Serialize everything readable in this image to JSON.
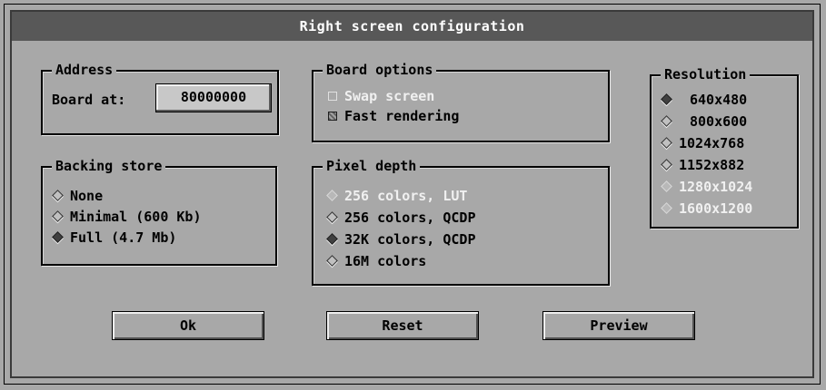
{
  "window": {
    "title": "Right screen configuration"
  },
  "address": {
    "legend": "Address",
    "board_label": "Board at:",
    "board_value": "80000000"
  },
  "board_options": {
    "legend": "Board options",
    "items": [
      {
        "label": "Swap screen",
        "checked": false,
        "enabled": false
      },
      {
        "label": "Fast rendering",
        "checked": true,
        "enabled": true
      }
    ]
  },
  "resolution": {
    "legend": "Resolution",
    "items": [
      {
        "label": "640x480",
        "selected": true,
        "enabled": true
      },
      {
        "label": "800x600",
        "selected": false,
        "enabled": true
      },
      {
        "label": "1024x768",
        "selected": false,
        "enabled": true
      },
      {
        "label": "1152x882",
        "selected": false,
        "enabled": true
      },
      {
        "label": "1280x1024",
        "selected": false,
        "enabled": false
      },
      {
        "label": "1600x1200",
        "selected": false,
        "enabled": false
      }
    ]
  },
  "backing_store": {
    "legend": "Backing store",
    "items": [
      {
        "label": "None",
        "selected": false,
        "enabled": true
      },
      {
        "label": "Minimal (600 Kb)",
        "selected": false,
        "enabled": true
      },
      {
        "label": "Full (4.7 Mb)",
        "selected": true,
        "enabled": true
      }
    ]
  },
  "pixel_depth": {
    "legend": "Pixel depth",
    "items": [
      {
        "label": "256 colors, LUT",
        "selected": false,
        "enabled": false
      },
      {
        "label": "256 colors, QCDP",
        "selected": false,
        "enabled": true
      },
      {
        "label": "32K colors, QCDP",
        "selected": true,
        "enabled": true
      },
      {
        "label": "16M colors",
        "selected": false,
        "enabled": true
      }
    ]
  },
  "buttons": {
    "ok": "Ok",
    "reset": "Reset",
    "preview": "Preview"
  },
  "colors": {
    "title_bg": "#585858",
    "title_fg": "#ffffff",
    "dialog_bg": "#a8a8a8",
    "disabled_fg": "#f0f0f0"
  }
}
